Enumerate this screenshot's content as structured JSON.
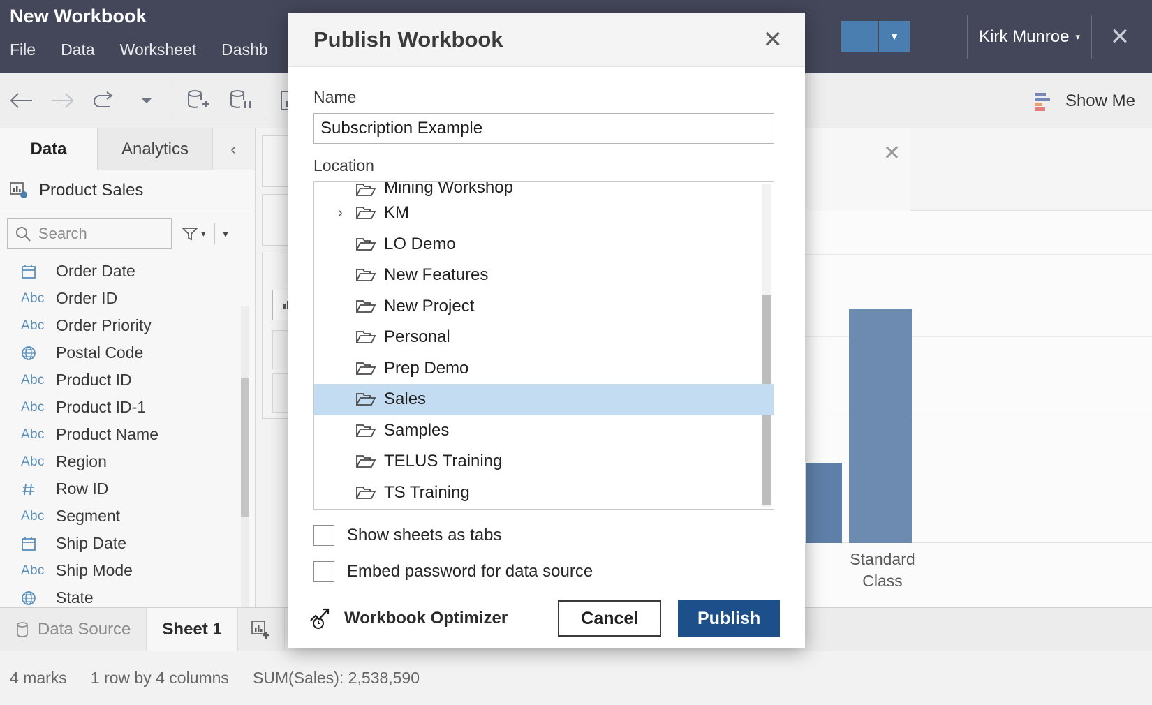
{
  "window": {
    "workbook_title": "New Workbook",
    "menus": [
      "File",
      "Data",
      "Worksheet",
      "Dashb"
    ],
    "user_name": "Kirk Munroe",
    "user_caret": "▾",
    "close_icon": "close-icon"
  },
  "toolbar": {
    "back_icon": "back-arrow-icon",
    "forward_icon": "forward-arrow-icon",
    "undo_icon": "redo-icon",
    "undo_caret": "▾",
    "new_datasource_icon": "new-data-source-icon",
    "pause_datasource_icon": "pause-data-source-icon",
    "chart_icon": "chart-icon",
    "show_me_label": "Show Me",
    "show_me_icon": "show-me-icon"
  },
  "sidebar": {
    "tabs": [
      {
        "label": "Data",
        "active": true
      },
      {
        "label": "Analytics",
        "active": false
      }
    ],
    "collapse_icon": "‹",
    "data_source": "Product Sales",
    "data_source_icon": "data-source-icon",
    "search": {
      "placeholder": "Search",
      "value": "",
      "icon": "search-icon"
    },
    "filter_icon": "filter-icon",
    "sort_caret": "▾",
    "fields": [
      {
        "icon": "calendar",
        "name": "Order Date"
      },
      {
        "icon": "abc",
        "name": "Order ID"
      },
      {
        "icon": "abc",
        "name": "Order Priority"
      },
      {
        "icon": "globe",
        "name": "Postal Code"
      },
      {
        "icon": "abc",
        "name": "Product ID"
      },
      {
        "icon": "abc",
        "name": "Product ID-1"
      },
      {
        "icon": "abc",
        "name": "Product Name"
      },
      {
        "icon": "abc",
        "name": "Region"
      },
      {
        "icon": "hash",
        "name": "Row ID"
      },
      {
        "icon": "abc",
        "name": "Segment"
      },
      {
        "icon": "calendar",
        "name": "Ship Date"
      },
      {
        "icon": "abc",
        "name": "Ship Mode"
      },
      {
        "icon": "globe",
        "name": "State"
      }
    ]
  },
  "dialog": {
    "title": "Publish Workbook",
    "close_icon": "close-icon",
    "name_label": "Name",
    "name_value": "Subscription Example",
    "location_label": "Location",
    "folders": [
      {
        "name": "Mining Workshop",
        "expandable": false,
        "selected": false,
        "clipped": true
      },
      {
        "name": "KM",
        "expandable": true,
        "selected": false,
        "clipped": false
      },
      {
        "name": "LO Demo",
        "expandable": false,
        "selected": false,
        "clipped": false
      },
      {
        "name": "New Features",
        "expandable": false,
        "selected": false,
        "clipped": false
      },
      {
        "name": "New Project",
        "expandable": false,
        "selected": false,
        "clipped": false
      },
      {
        "name": "Personal",
        "expandable": false,
        "selected": false,
        "clipped": false
      },
      {
        "name": "Prep Demo",
        "expandable": false,
        "selected": false,
        "clipped": false
      },
      {
        "name": "Sales",
        "expandable": false,
        "selected": true,
        "clipped": false
      },
      {
        "name": "Samples",
        "expandable": false,
        "selected": false,
        "clipped": false
      },
      {
        "name": "TELUS Training",
        "expandable": false,
        "selected": false,
        "clipped": false
      },
      {
        "name": "TS Training",
        "expandable": false,
        "selected": false,
        "clipped": false
      }
    ],
    "expand_chevron": "›",
    "checkboxes": [
      {
        "label": "Show sheets as tabs",
        "checked": false
      },
      {
        "label": "Embed password for data source",
        "checked": false
      }
    ],
    "optimizer_label": "Workbook Optimizer",
    "optimizer_icon": "optimizer-icon",
    "cancel_label": "Cancel",
    "publish_label": "Publish",
    "accent_color": "#1d4f8a",
    "selection_color": "#c3dcf2"
  },
  "sheet_tabs": {
    "data_source_label": "Data Source",
    "data_source_icon": "database-icon",
    "sheets": [
      {
        "label": "Sheet 1",
        "active": true
      }
    ],
    "new_sheet_icon": "new-worksheet-icon"
  },
  "status_bar": {
    "marks": "4 marks",
    "rows_cols": "1 row by 4 columns",
    "aggregate": "SUM(Sales): 2,538,590"
  },
  "chart_data": {
    "type": "bar",
    "categories": [
      "Standard Class"
    ],
    "visible_bars": [
      {
        "label": "",
        "value": 0.25,
        "color": "#5e7fa8"
      },
      {
        "label": "Standard Class",
        "value": 0.75,
        "color": "#6d8bb0"
      }
    ],
    "title": "",
    "xlabel": "",
    "ylabel": "",
    "grid": true,
    "note": "Bar chart mostly occluded by the Publish Workbook dialog; only the right-most bars are visible."
  }
}
